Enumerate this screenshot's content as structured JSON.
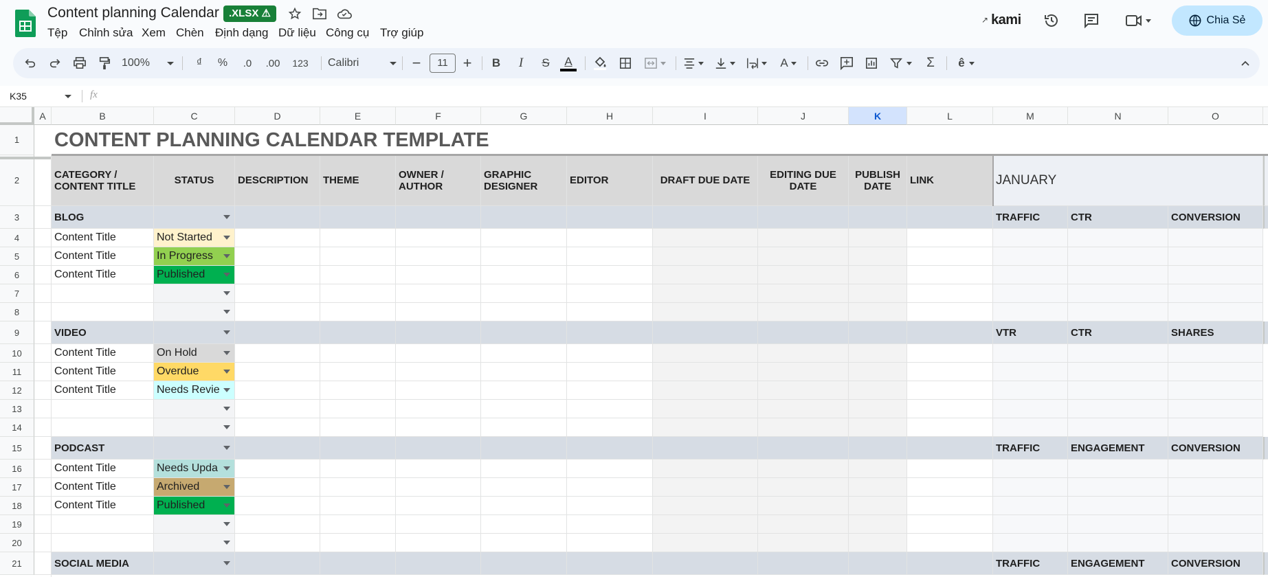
{
  "doc": {
    "title": "Content planning Calendar",
    "badge": ".XLSX ⚠",
    "menu": [
      "Tệp",
      "Chỉnh sửa",
      "Xem",
      "Chèn",
      "Định dạng",
      "Dữ liệu",
      "Công cụ",
      "Trợ giúp"
    ],
    "kami": "kami",
    "share_label": "Chia Sẻ"
  },
  "toolbar": {
    "zoom": "100%",
    "currency": "₫",
    "percent": "%",
    "dec_less": ".0",
    "dec_more": ".00",
    "format_num": "123",
    "font": "Calibri",
    "font_size": "11"
  },
  "formula_bar": {
    "cell_ref": "K35",
    "fx": "fx",
    "value": ""
  },
  "columns": [
    "A",
    "B",
    "C",
    "D",
    "E",
    "F",
    "G",
    "H",
    "I",
    "J",
    "K",
    "L",
    "M",
    "N",
    "O"
  ],
  "rows": [
    "1",
    "2",
    "3",
    "4",
    "5",
    "6",
    "7",
    "8",
    "9",
    "10",
    "11",
    "12",
    "13",
    "14",
    "15",
    "16",
    "17",
    "18",
    "19",
    "20",
    "21"
  ],
  "sheet": {
    "title": "CONTENT PLANNING CALENDAR TEMPLATE",
    "headers": {
      "b": "CATEGORY / CONTENT TITLE",
      "c": "STATUS",
      "d": "DESCRIPTION",
      "e": "THEME",
      "f": "OWNER / AUTHOR",
      "g": "GRAPHIC DESIGNER",
      "h": "EDITOR",
      "i": "DRAFT DUE DATE",
      "j": "EDITING DUE DATE",
      "k": "PUBLISH DATE",
      "l": "LINK",
      "month": "JANUARY"
    },
    "categories": [
      {
        "name": "BLOG",
        "metrics": [
          "TRAFFIC",
          "CTR",
          "CONVERSION"
        ],
        "items": [
          {
            "title": "Content Title",
            "status": "Not Started",
            "color": "#fff2cc"
          },
          {
            "title": "Content Title",
            "status": "In Progress",
            "color": "#92d050"
          },
          {
            "title": "Content Title",
            "status": "Published",
            "color": "#00b050"
          },
          {
            "title": "",
            "status": "",
            "color": ""
          },
          {
            "title": "",
            "status": "",
            "color": ""
          }
        ]
      },
      {
        "name": "VIDEO",
        "metrics": [
          "VTR",
          "CTR",
          "SHARES"
        ],
        "items": [
          {
            "title": "Content Title",
            "status": "On Hold",
            "color": "#d9d9d9"
          },
          {
            "title": "Content Title",
            "status": "Overdue",
            "color": "#ffd966"
          },
          {
            "title": "Content Title",
            "status": "Needs Revie",
            "color": "#ccffff"
          },
          {
            "title": "",
            "status": "",
            "color": ""
          },
          {
            "title": "",
            "status": "",
            "color": ""
          }
        ]
      },
      {
        "name": "PODCAST",
        "metrics": [
          "TRAFFIC",
          "ENGAGEMENT",
          "CONVERSION"
        ],
        "items": [
          {
            "title": "Content Title",
            "status": "Needs Upda",
            "color": "#b4e0dc"
          },
          {
            "title": "Content Title",
            "status": "Archived",
            "color": "#c6a970"
          },
          {
            "title": "Content Title",
            "status": "Published",
            "color": "#00b050"
          },
          {
            "title": "",
            "status": "",
            "color": ""
          },
          {
            "title": "",
            "status": "",
            "color": ""
          }
        ]
      },
      {
        "name": "SOCIAL MEDIA",
        "metrics": [
          "TRAFFIC",
          "ENGAGEMENT",
          "CONVERSION"
        ],
        "items": []
      }
    ]
  },
  "colors": {
    "sheets_green": "#0f9d58",
    "share_bg": "#c2e7ff",
    "category_bg": "#d6dce4",
    "header_bg": "#d9d9d9",
    "selected_col": "#d3e3fd"
  }
}
